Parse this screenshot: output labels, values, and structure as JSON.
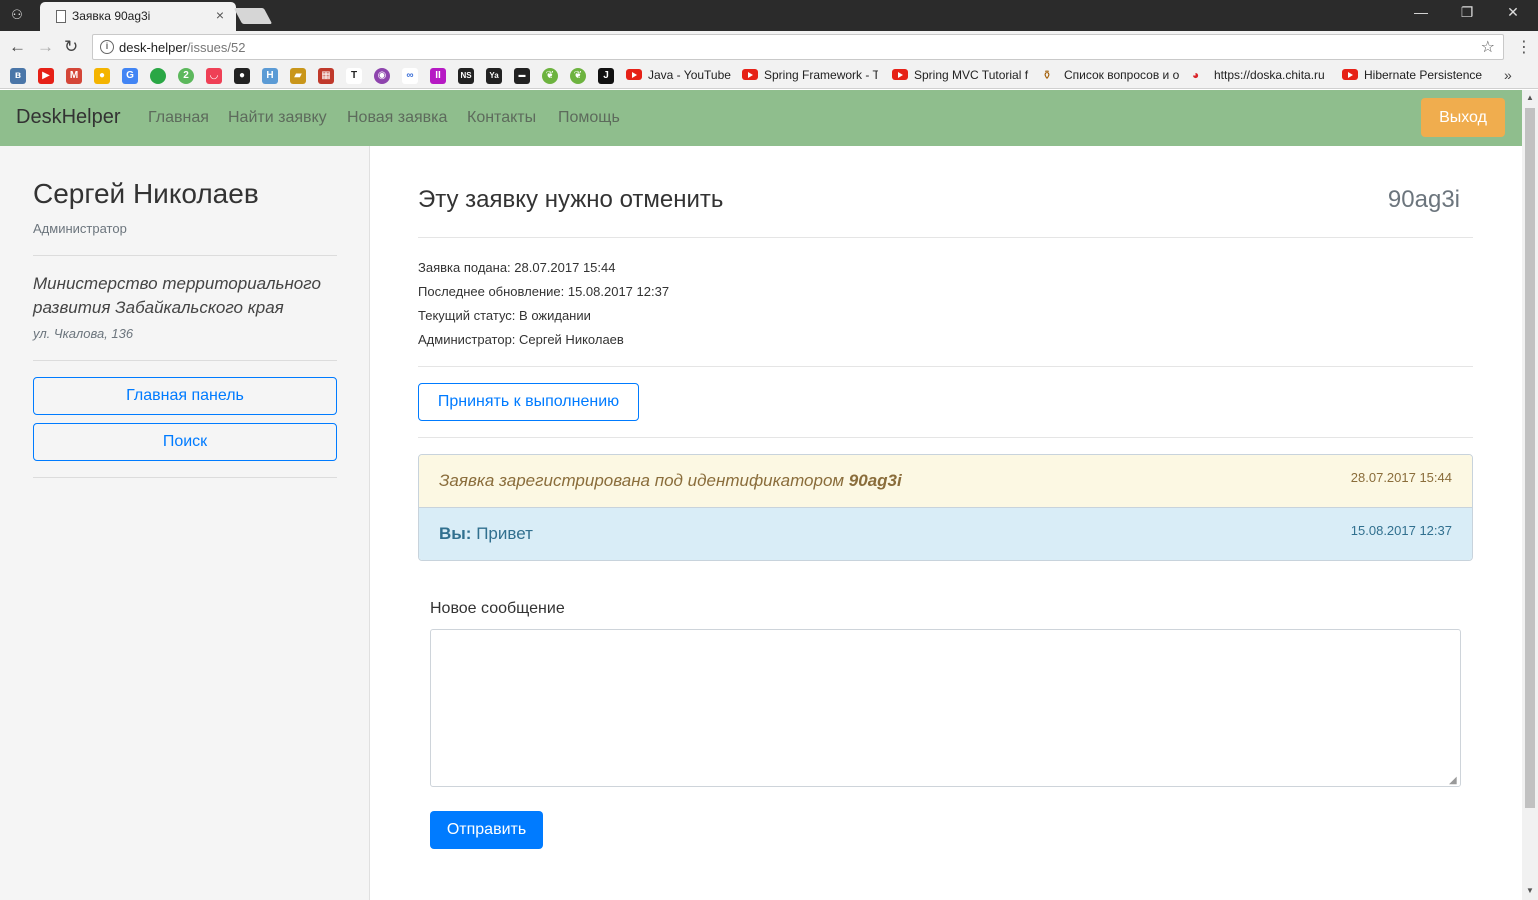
{
  "browser": {
    "tab_title": "Заявка 90ag3i",
    "tab_close": "×",
    "url_host": "desk-helper",
    "url_path": "/issues/52",
    "bookmarks": [
      {
        "label": "Java - YouTube"
      },
      {
        "label": "Spring Framework - T"
      },
      {
        "label": "Spring MVC Tutorial f"
      },
      {
        "label": "Список вопросов и о"
      },
      {
        "label": "https://doska.chita.ru"
      },
      {
        "label": "Hibernate Persistence"
      }
    ],
    "bookmark_more": "»",
    "window_controls": {
      "minimize": "—",
      "restore": "❐",
      "close": "✕"
    }
  },
  "navbar": {
    "brand": "DeskHelper",
    "links": [
      "Главная",
      "Найти заявку",
      "Новая заявка",
      "Контакты",
      "Помощь"
    ],
    "logout": "Выход"
  },
  "sidebar": {
    "user_name": "Сергей Николаев",
    "user_role": "Администратор",
    "org_name": "Министерство территориального развития Забайкальского края",
    "org_address": "ул. Чкалова, 136",
    "buttons": [
      "Главная панель",
      "Поиск"
    ]
  },
  "issue": {
    "title": "Эту заявку нужно отменить",
    "code": "90ag3i",
    "meta": [
      "Заявка подана: 28.07.2017 15:44",
      "Последнее обновление: 15.08.2017 12:37",
      "Текущий статус: В ожидании",
      "Администратор: Сергей Николаев"
    ],
    "accept_button": "Прнинять к выполнению",
    "messages": [
      {
        "text": "Заявка зарегистрирована под идентификатором ",
        "code": "90ag3i",
        "time": "28.07.2017 15:44"
      },
      {
        "author": "Вы:",
        "text": "Привет",
        "time": "15.08.2017 12:37"
      }
    ],
    "new_message_label": "Новое сообщение",
    "new_message_value": "",
    "send_button": "Отправить"
  }
}
